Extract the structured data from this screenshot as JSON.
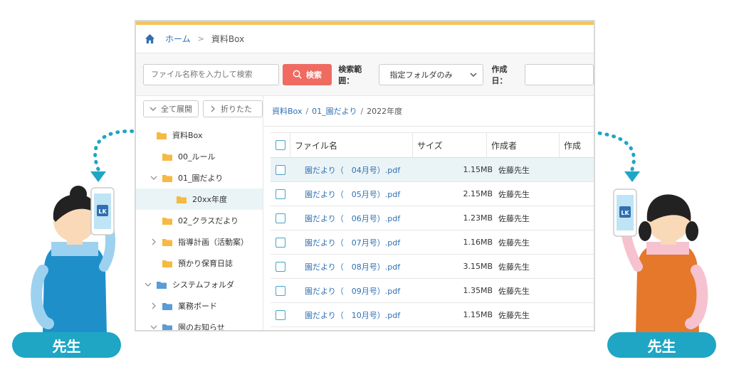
{
  "app": {
    "breadcrumb": {
      "home": "ホーム",
      "current": "資料Box"
    },
    "search": {
      "placeholder": "ファイル名称を入力して検索",
      "button": "検索",
      "scope_label": "検索範囲：",
      "scope_value": "指定フォルダのみ",
      "date_label": "作成日："
    },
    "tree": {
      "expand_all": "全て展開",
      "collapse_all": "折りたた",
      "items": [
        {
          "label": "資料Box",
          "depth": 0,
          "chevron": "none",
          "selected": false,
          "color": "#f5b942"
        },
        {
          "label": "00_ルール",
          "depth": 1,
          "chevron": "none",
          "selected": false,
          "color": "#f5b942"
        },
        {
          "label": "01_園だより",
          "depth": 1,
          "chevron": "down",
          "selected": false,
          "color": "#f5b942"
        },
        {
          "label": "20xx年度",
          "depth": 2,
          "chevron": "none",
          "selected": true,
          "color": "#f5b942"
        },
        {
          "label": "02_クラスだより",
          "depth": 1,
          "chevron": "none",
          "selected": false,
          "color": "#f5b942"
        },
        {
          "label": "指導計画（活動案）",
          "depth": 1,
          "chevron": "right",
          "selected": false,
          "color": "#f5b942"
        },
        {
          "label": "預かり保育日誌",
          "depth": 1,
          "chevron": "none",
          "selected": false,
          "color": "#f5b942"
        },
        {
          "label": "システムフォルダ",
          "depth": 0,
          "chevron": "down",
          "selected": false,
          "color": "#5b9bd5"
        },
        {
          "label": "業務ボード",
          "depth": 1,
          "chevron": "right",
          "selected": false,
          "color": "#5b9bd5"
        },
        {
          "label": "園のお知らせ",
          "depth": 1,
          "chevron": "down",
          "selected": false,
          "color": "#5b9bd5"
        }
      ]
    },
    "path": {
      "root": "資料Box",
      "sep1": "/",
      "folder": "01_園だより",
      "sep2": "/",
      "current": "2022年度"
    },
    "table": {
      "columns": [
        "ファイル名",
        "サイズ",
        "作成者",
        "作成"
      ],
      "rows": [
        {
          "name": "園だより（　04月号）.pdf",
          "size": "1.15MB",
          "by": "佐藤先生"
        },
        {
          "name": "園だより（　05月号）.pdf",
          "size": "2.15MB",
          "by": "佐藤先生"
        },
        {
          "name": "園だより（　06月号）.pdf",
          "size": "1.23MB",
          "by": "佐藤先生"
        },
        {
          "name": "園だより（　07月号）.pdf",
          "size": "1.16MB",
          "by": "佐藤先生"
        },
        {
          "name": "園だより（　08月号）.pdf",
          "size": "3.15MB",
          "by": "佐藤先生"
        },
        {
          "name": "園だより（　09月号）.pdf",
          "size": "1.35MB",
          "by": "佐藤先生"
        },
        {
          "name": "園だより（　10月号）.pdf",
          "size": "1.15MB",
          "by": "佐藤先生"
        }
      ]
    }
  },
  "figures": {
    "left_label": "先生",
    "right_label": "先生",
    "phone_logo": "LK",
    "accent": "#1ea6c4"
  }
}
